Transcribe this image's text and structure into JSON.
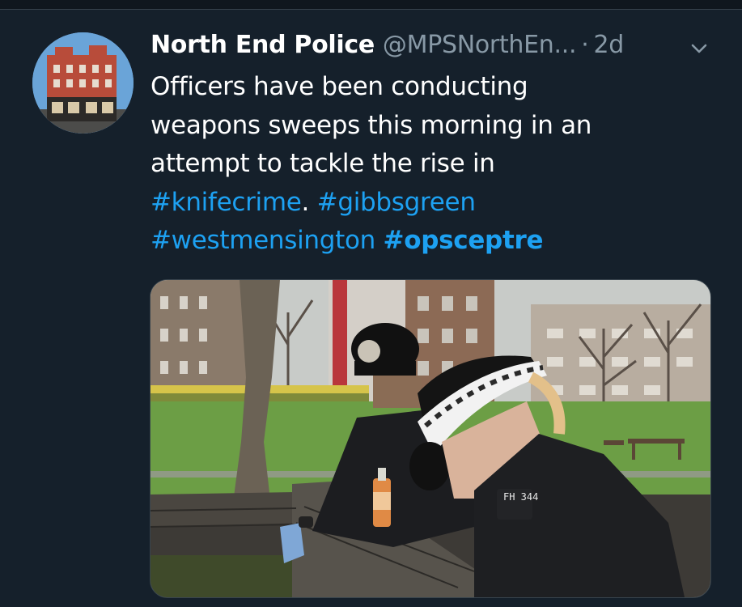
{
  "tweet": {
    "author_name": "North End Police",
    "author_handle": "@MPSNorthEn...",
    "separator": "·",
    "time": "2d",
    "text_lines": {
      "l1": "Officers have been conducting",
      "l2": "weapons sweeps this morning in an",
      "l3": "attempt to tackle the rise in"
    },
    "hashtags": {
      "knifecrime": "#knifecrime",
      "period": ".",
      "gibbsgreen": "#gibbsgreen",
      "westmensington": "#westmensington",
      "opsceptre": "#opsceptre"
    },
    "media": {
      "badge_text": "FH 344"
    }
  },
  "icons": {
    "avatar": "building-avatar",
    "menu": "chevron-down-icon"
  },
  "colors": {
    "background": "#15202b",
    "text": "#ffffff",
    "secondary": "#8899a6",
    "link": "#1da1f2"
  }
}
